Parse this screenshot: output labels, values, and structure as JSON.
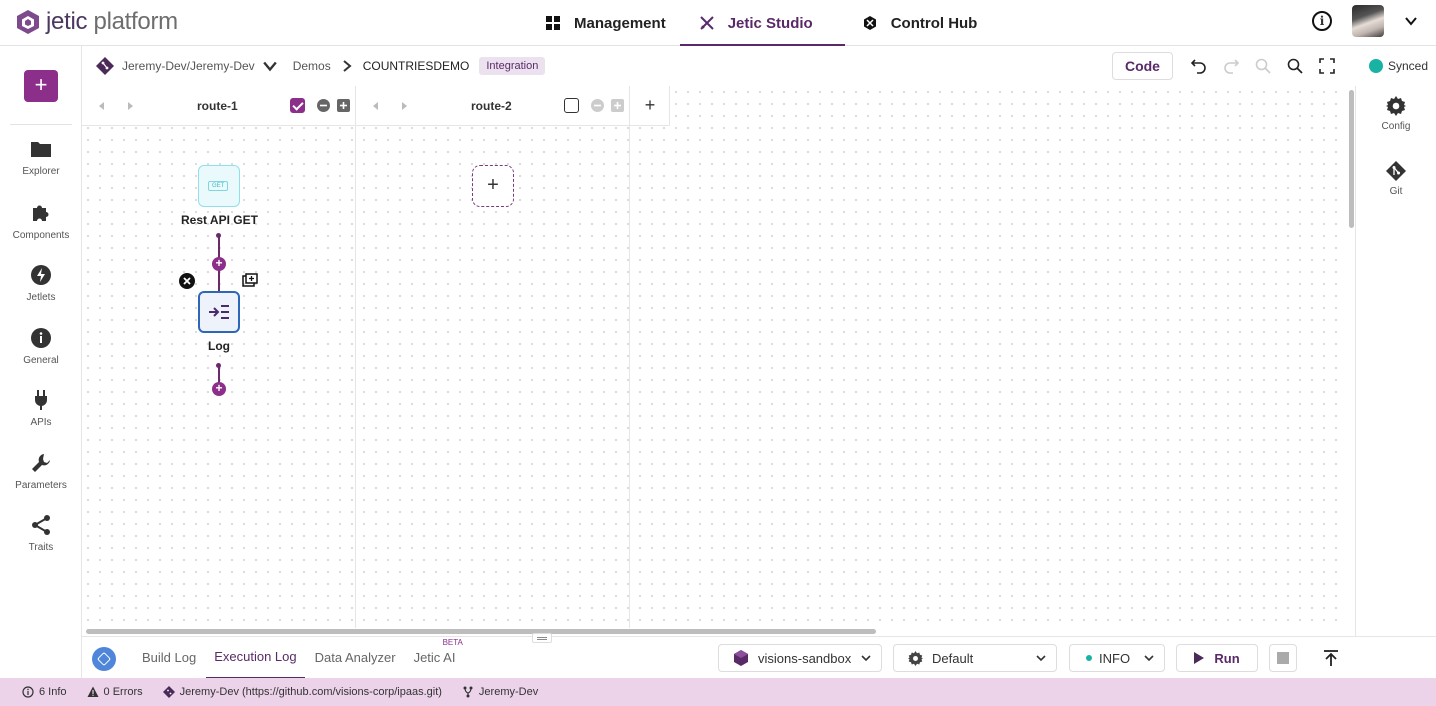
{
  "app": {
    "brand_strong": "jetic",
    "brand_light": " platform"
  },
  "topnav": [
    {
      "label": "Management",
      "icon": "grid-icon"
    },
    {
      "label": "Jetic Studio",
      "icon": "studio-icon",
      "active": true
    },
    {
      "label": "Control Hub",
      "icon": "hub-icon"
    }
  ],
  "sidebar": {
    "items": [
      {
        "label": "Explorer",
        "icon": "folder-icon"
      },
      {
        "label": "Components",
        "icon": "puzzle-icon"
      },
      {
        "label": "Jetlets",
        "icon": "bolt-icon"
      },
      {
        "label": "General",
        "icon": "info-icon"
      },
      {
        "label": "APIs",
        "icon": "plug-icon"
      },
      {
        "label": "Parameters",
        "icon": "wrench-icon"
      },
      {
        "label": "Traits",
        "icon": "share-icon"
      }
    ]
  },
  "breadcrumb": {
    "repo": "Jeremy-Dev/Jeremy-Dev",
    "folder": "Demos",
    "project": "COUNTRIESDEMO",
    "badge": "Integration"
  },
  "toolbar": {
    "code_label": "Code",
    "sync_status": "Synced"
  },
  "routes": [
    {
      "name": "route-1",
      "selected": true
    },
    {
      "name": "route-2",
      "selected": false
    }
  ],
  "nodes": {
    "rest_label": "Rest API GET",
    "rest_tag": "GET",
    "log_label": "Log"
  },
  "rightpanel": [
    {
      "label": "Config",
      "icon": "gear-icon"
    },
    {
      "label": "Git",
      "icon": "git-icon"
    }
  ],
  "bottom": {
    "tabs": [
      {
        "label": "Build Log"
      },
      {
        "label": "Execution Log",
        "active": true
      },
      {
        "label": "Data Analyzer"
      },
      {
        "label": "Jetic AI",
        "badge": "BETA"
      }
    ],
    "environment": "visions-sandbox",
    "profile": "Default",
    "log_level": "INFO",
    "run_label": "Run"
  },
  "status": {
    "info": "6 Info",
    "errors": "0 Errors",
    "repo": "Jeremy-Dev (https://github.com/visions-corp/ipaas.git)",
    "branch": "Jeremy-Dev"
  },
  "colors": {
    "accent": "#8b2f8a",
    "brand": "#5a2a68",
    "statusbar": "#ecd3ea",
    "synced": "#19b3a6"
  }
}
